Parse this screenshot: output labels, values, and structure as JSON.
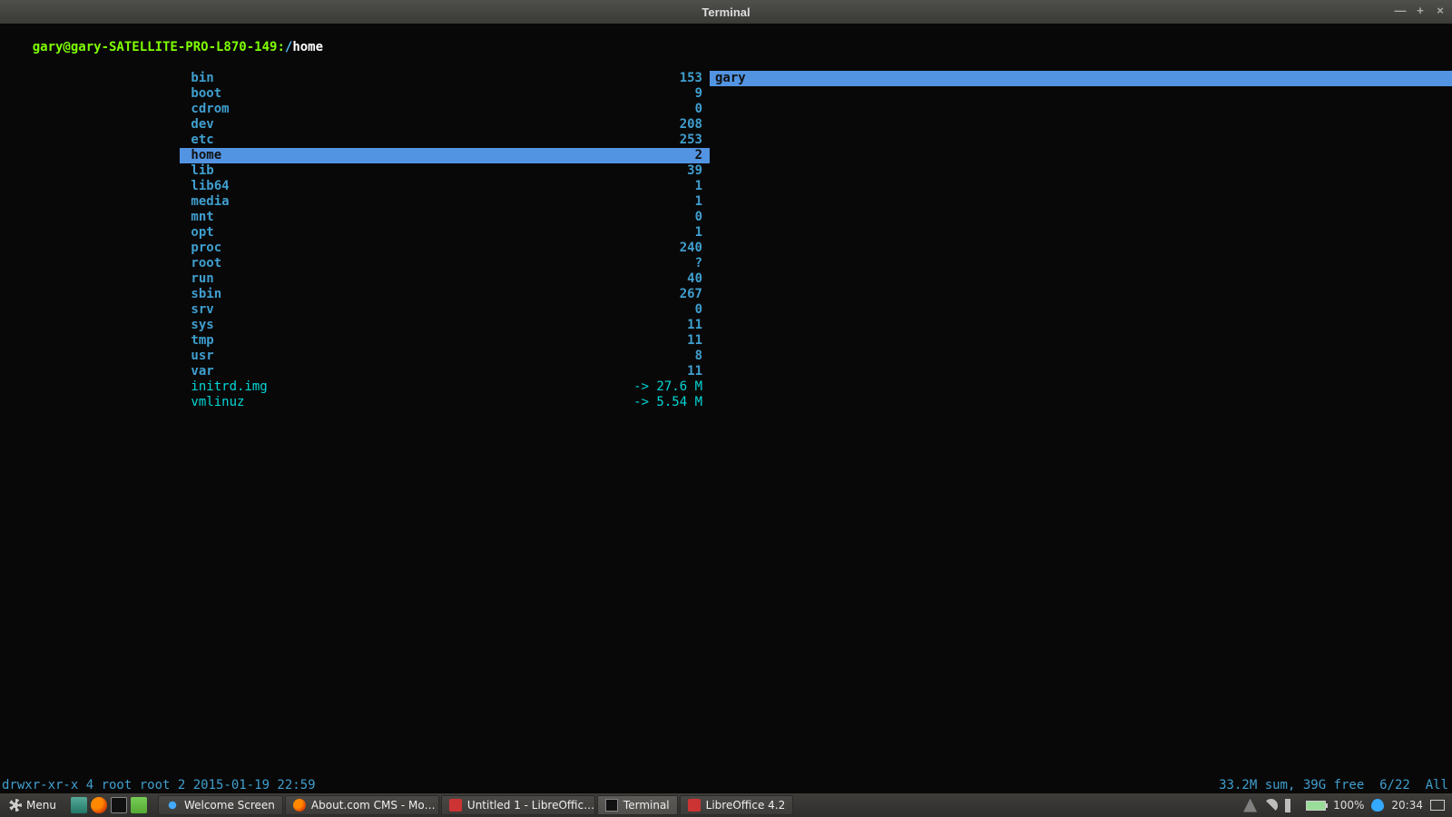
{
  "window": {
    "title": "Terminal",
    "min": "—",
    "max": "+",
    "close": "×"
  },
  "path": {
    "userhost": "gary@gary-SATELLITE-PRO-L870-149",
    "sep": ":",
    "root": "/",
    "current": "home"
  },
  "mid": [
    {
      "name": "bin",
      "size": "153",
      "type": "dir"
    },
    {
      "name": "boot",
      "size": "9",
      "type": "dir"
    },
    {
      "name": "cdrom",
      "size": "0",
      "type": "dir"
    },
    {
      "name": "dev",
      "size": "208",
      "type": "dir"
    },
    {
      "name": "etc",
      "size": "253",
      "type": "dir"
    },
    {
      "name": "home",
      "size": "2",
      "type": "dir",
      "selected": true
    },
    {
      "name": "lib",
      "size": "39",
      "type": "dir"
    },
    {
      "name": "lib64",
      "size": "1",
      "type": "dir"
    },
    {
      "name": "media",
      "size": "1",
      "type": "dir"
    },
    {
      "name": "mnt",
      "size": "0",
      "type": "dir"
    },
    {
      "name": "opt",
      "size": "1",
      "type": "dir"
    },
    {
      "name": "proc",
      "size": "240",
      "type": "dir"
    },
    {
      "name": "root",
      "size": "?",
      "type": "dir"
    },
    {
      "name": "run",
      "size": "40",
      "type": "dir"
    },
    {
      "name": "sbin",
      "size": "267",
      "type": "dir"
    },
    {
      "name": "srv",
      "size": "0",
      "type": "dir"
    },
    {
      "name": "sys",
      "size": "11",
      "type": "dir"
    },
    {
      "name": "tmp",
      "size": "11",
      "type": "dir"
    },
    {
      "name": "usr",
      "size": "8",
      "type": "dir"
    },
    {
      "name": "var",
      "size": "11",
      "type": "dir"
    },
    {
      "name": "initrd.img",
      "size": "-> 27.6 M",
      "type": "symlink"
    },
    {
      "name": "vmlinuz",
      "size": "-> 5.54 M",
      "type": "symlink"
    }
  ],
  "right": [
    {
      "name": "gary",
      "selected": true
    }
  ],
  "status": {
    "left": "drwxr-xr-x 4 root root 2 2015-01-19 22:59",
    "right": "33.2M sum, 39G free  6/22  All"
  },
  "taskbar": {
    "menu": "Menu",
    "tasks": [
      {
        "label": "Welcome Screen",
        "icon": "power"
      },
      {
        "label": "About.com CMS - Mo…",
        "icon": "fx"
      },
      {
        "label": "Untitled 1 - LibreOffic…",
        "icon": "doc"
      },
      {
        "label": "Terminal",
        "icon": "term",
        "active": true
      },
      {
        "label": "LibreOffice 4.2",
        "icon": "doc"
      }
    ],
    "battery_pct": "100%",
    "time": "20:34"
  }
}
